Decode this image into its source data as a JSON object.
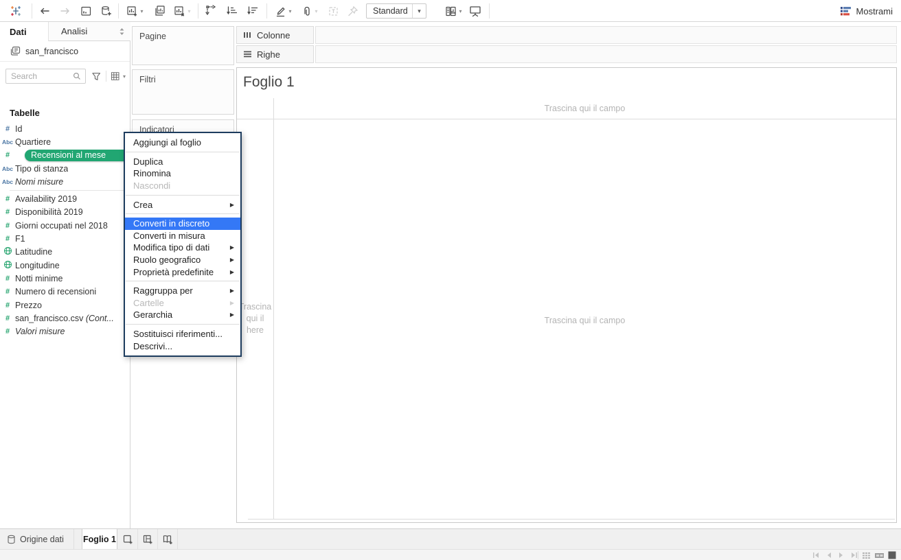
{
  "icons": {
    "submenu_arrow": "▶",
    "caret": "▾"
  },
  "toolbar": {
    "fit_value": "Standard",
    "show_me_label": "Mostrami",
    "icon_names": [
      "tableau-logo",
      "undo",
      "redo",
      "save",
      "new-data-source",
      "new-worksheet",
      "duplicate",
      "clear-sheet",
      "swap-axes",
      "sort-ascending",
      "sort-descending",
      "highlight",
      "group-members",
      "show-mark-labels",
      "fix-axes",
      "fit-selector",
      "show-hide-cards",
      "presentation-mode",
      "show-me"
    ]
  },
  "sidebar": {
    "tab_data": "Dati",
    "tab_analytics": "Analisi",
    "datasource": "san_francisco",
    "search_placeholder": "Search",
    "section_title": "Tabelle",
    "fields": [
      {
        "glyph": "#",
        "label": "Id",
        "kind": "dimension"
      },
      {
        "glyph": "Abc",
        "label": "Quartiere",
        "kind": "dimension"
      },
      {
        "glyph": "#",
        "label": "Recensioni al mese",
        "kind": "measure",
        "selected": true
      },
      {
        "glyph": "Abc",
        "label": "Tipo di stanza",
        "kind": "dimension"
      },
      {
        "glyph": "Abc",
        "label": "Nomi misure",
        "kind": "dimension",
        "italic": true
      },
      {
        "glyph": "#",
        "label": "Availability 2019",
        "kind": "measure"
      },
      {
        "glyph": "#",
        "label": "Disponibilità 2019",
        "kind": "measure"
      },
      {
        "glyph": "#",
        "label": "Giorni occupati nel 2018",
        "kind": "measure"
      },
      {
        "glyph": "#",
        "label": "F1",
        "kind": "measure"
      },
      {
        "glyph": "globe",
        "label": "Latitudine",
        "kind": "measure"
      },
      {
        "glyph": "globe",
        "label": "Longitudine",
        "kind": "measure"
      },
      {
        "glyph": "#",
        "label": "Notti minime",
        "kind": "measure"
      },
      {
        "glyph": "#",
        "label": "Numero di recensioni",
        "kind": "measure"
      },
      {
        "glyph": "#",
        "label": "Prezzo",
        "kind": "measure"
      },
      {
        "glyph": "#",
        "label": "san_francisco.csv ",
        "label_italic": "(Cont...",
        "kind": "measure"
      },
      {
        "glyph": "#",
        "label": "Valori misure",
        "kind": "measure",
        "italic": true
      }
    ]
  },
  "cards": {
    "pages": "Pagine",
    "filters": "Filtri",
    "marks": "Indicatori"
  },
  "shelves": {
    "columns": "Colonne",
    "rows": "Righe"
  },
  "canvas": {
    "sheet_title": "Foglio 1",
    "drop_hint_top": "Trascina qui il campo",
    "drop_hint_center": "Trascina qui il campo",
    "drop_hint_left": {
      "line1": "Trascina",
      "line2": "qui il",
      "line3": "here"
    }
  },
  "context_menu": {
    "items": [
      {
        "label": "Aggiungi al foglio"
      },
      {
        "label": "Duplica"
      },
      {
        "label": "Rinomina"
      },
      {
        "label": "Nascondi",
        "disabled": true
      },
      {
        "label": "Crea",
        "submenu": true
      },
      {
        "label": "Converti in discreto",
        "selected": true
      },
      {
        "label": "Converti in misura"
      },
      {
        "label": "Modifica tipo di dati",
        "submenu": true
      },
      {
        "label": "Ruolo geografico",
        "submenu": true
      },
      {
        "label": "Proprietà predefinite",
        "submenu": true
      },
      {
        "label": "Raggruppa per",
        "submenu": true
      },
      {
        "label": "Cartelle",
        "disabled": true,
        "submenu": true
      },
      {
        "label": "Gerarchia",
        "submenu": true
      },
      {
        "label": "Sostituisci riferimenti..."
      },
      {
        "label": "Descrivi..."
      }
    ]
  },
  "bottom_bar": {
    "datasource_tab": "Origine dati",
    "sheet_tab": "Foglio 1"
  },
  "colors": {
    "accent_green": "#21a672",
    "dimension_blue": "#4c77a4",
    "measure_green": "#23a36d",
    "selection_blue": "#3478f6",
    "menu_border": "#1d3c5e",
    "showme_blue": "#5b7db1",
    "showme_red": "#d94f43"
  }
}
